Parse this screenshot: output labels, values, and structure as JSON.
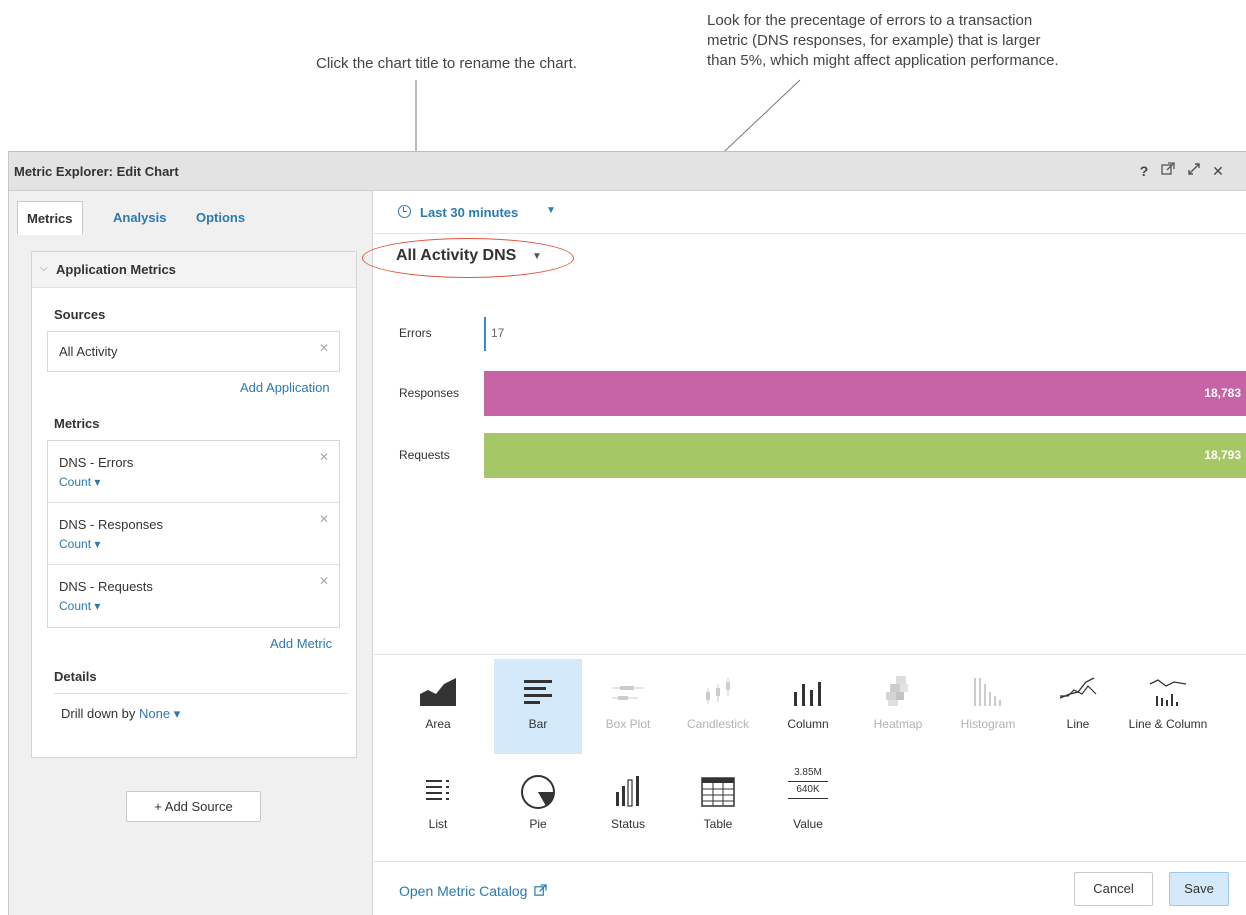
{
  "callouts": {
    "title_hint": "Click the chart title to rename the chart.",
    "errors_hint": "Look for the precentage of errors to a transaction\nmetric (DNS responses, for example) that is larger\nthan 5%, which might affect application performance."
  },
  "window": {
    "title": "Metric Explorer: Edit Chart",
    "icons": [
      "help-icon",
      "external-link-icon",
      "expand-icon",
      "close-icon"
    ]
  },
  "tabs": [
    "Metrics",
    "Analysis",
    "Options"
  ],
  "panel": {
    "header": "Application Metrics",
    "sources_title": "Sources",
    "sources": [
      {
        "name": "All Activity"
      }
    ],
    "add_application": "Add Application",
    "metrics_title": "Metrics",
    "metrics": [
      {
        "name": "DNS - Errors",
        "agg": "Count"
      },
      {
        "name": "DNS - Responses",
        "agg": "Count"
      },
      {
        "name": "DNS - Requests",
        "agg": "Count"
      }
    ],
    "add_metric": "Add Metric",
    "details_title": "Details",
    "drill_label": "Drill down by",
    "drill_value": "None"
  },
  "add_source": "+ Add Source",
  "time_range": "Last 30 minutes",
  "chart_title": "All Activity DNS",
  "chart_data": {
    "type": "bar",
    "categories": [
      "Errors",
      "Responses",
      "Requests"
    ],
    "values": [
      17,
      18783,
      18793
    ],
    "value_labels": [
      "17",
      "18,783",
      "18,793"
    ],
    "colors": [
      "#3a8bc7",
      "#c664a6",
      "#a6c766"
    ]
  },
  "viz_types": [
    {
      "name": "Area",
      "icon": "area-chart-icon",
      "state": "normal"
    },
    {
      "name": "Bar",
      "icon": "bar-chart-icon",
      "state": "selected"
    },
    {
      "name": "Box Plot",
      "icon": "box-plot-icon",
      "state": "disabled"
    },
    {
      "name": "Candlestick",
      "icon": "candlestick-icon",
      "state": "disabled"
    },
    {
      "name": "Column",
      "icon": "column-chart-icon",
      "state": "normal"
    },
    {
      "name": "Heatmap",
      "icon": "heatmap-icon",
      "state": "disabled"
    },
    {
      "name": "Histogram",
      "icon": "histogram-icon",
      "state": "disabled"
    },
    {
      "name": "Line",
      "icon": "line-chart-icon",
      "state": "normal"
    },
    {
      "name": "Line & Column",
      "icon": "line-column-icon",
      "state": "normal"
    },
    {
      "name": "List",
      "icon": "list-icon",
      "state": "normal"
    },
    {
      "name": "Pie",
      "icon": "pie-chart-icon",
      "state": "normal"
    },
    {
      "name": "Status",
      "icon": "status-icon",
      "state": "normal"
    },
    {
      "name": "Table",
      "icon": "table-icon",
      "state": "normal"
    },
    {
      "name": "Value",
      "icon": "value-icon",
      "state": "normal"
    }
  ],
  "value_icon_text": [
    "3.85M",
    "640K"
  ],
  "footer": {
    "catalog_link": "Open Metric Catalog",
    "cancel": "Cancel",
    "save": "Save"
  }
}
